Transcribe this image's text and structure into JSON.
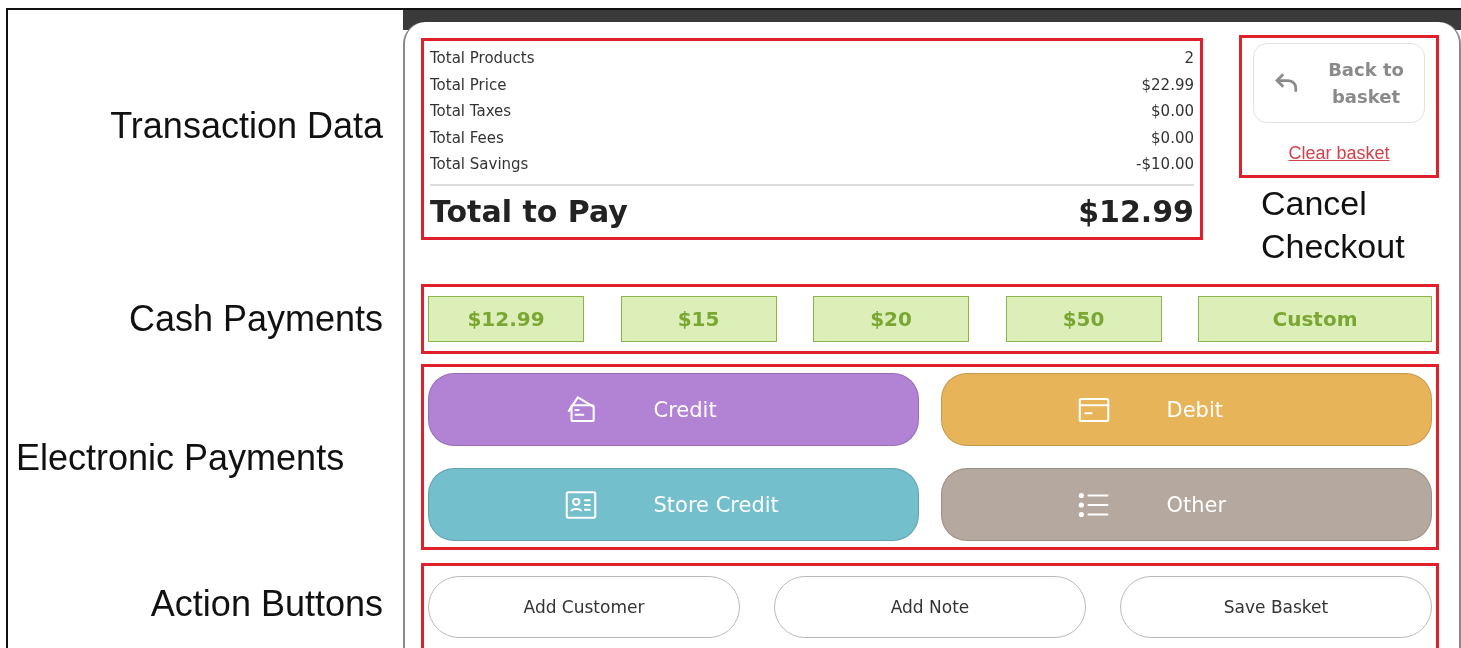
{
  "annotations": {
    "transaction": "Transaction Data",
    "cancel": "Cancel Checkout",
    "cash": "Cash Payments",
    "electronic": "Electronic Payments",
    "actions": "Action Buttons"
  },
  "summary": [
    {
      "label": "Total Products",
      "value": "2"
    },
    {
      "label": "Total Price",
      "value": "$22.99"
    },
    {
      "label": "Total Taxes",
      "value": "$0.00"
    },
    {
      "label": "Total Fees",
      "value": "$0.00"
    },
    {
      "label": "Total Savings",
      "value": "-$10.00"
    }
  ],
  "total": {
    "label": "Total to Pay",
    "value": "$12.99"
  },
  "back_button": "Back to basket",
  "clear_link": "Clear basket",
  "cash_buttons": [
    "$12.99",
    "$15",
    "$20",
    "$50",
    "Custom"
  ],
  "electronic_buttons": [
    {
      "label": "Credit",
      "kind": "cards",
      "color": "#b282d4"
    },
    {
      "label": "Debit",
      "kind": "card",
      "color": "#e8b45a"
    },
    {
      "label": "Store Credit",
      "kind": "id",
      "color": "#74bfcc"
    },
    {
      "label": "Other",
      "kind": "list",
      "color": "#b5a89e"
    }
  ],
  "action_buttons": [
    "Add Customer",
    "Add Note",
    "Save Basket"
  ]
}
